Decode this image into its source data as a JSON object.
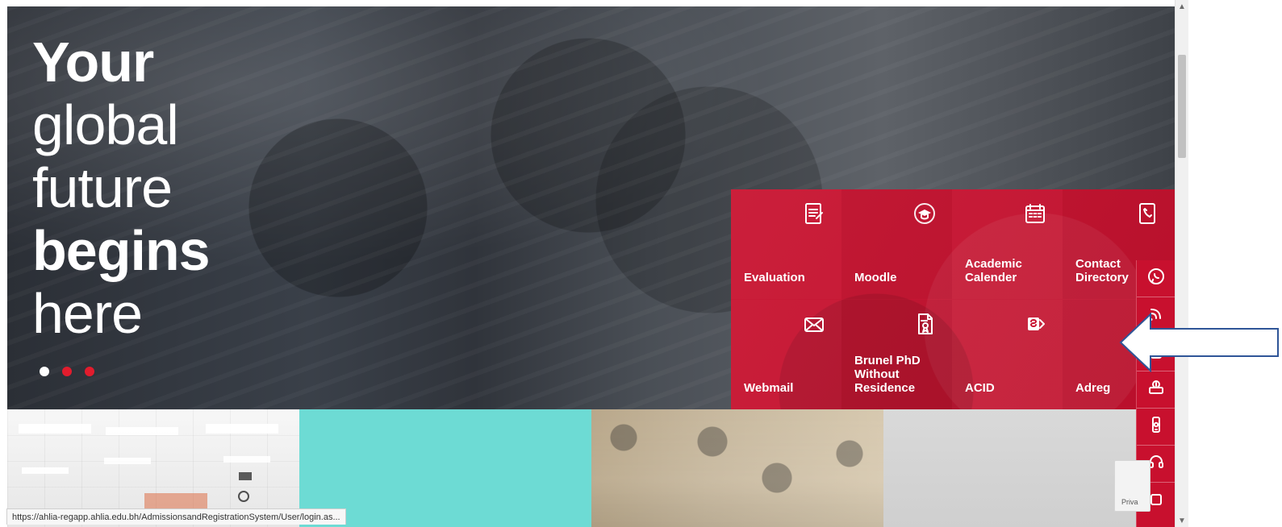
{
  "hero": {
    "headline": {
      "line1": "Your",
      "line2": "global",
      "line3": "future",
      "line4": "begins",
      "line5": "here"
    },
    "carousel": {
      "dots": [
        "active",
        "inactive",
        "inactive"
      ]
    }
  },
  "quick_links": {
    "tiles": [
      {
        "label": "Evaluation",
        "icon": "edit-document-icon"
      },
      {
        "label": "Moodle",
        "icon": "graduation-cap-icon"
      },
      {
        "label": "Academic\nCalender",
        "icon": "calendar-icon"
      },
      {
        "label": "Contact\nDirectory",
        "icon": "contact-directory-icon"
      },
      {
        "label": "Webmail",
        "icon": "mail-icon"
      },
      {
        "label": "Brunel PhD\nWithout\nResidence",
        "icon": "certificate-document-icon"
      },
      {
        "label": "ACID",
        "icon": "sharepoint-icon"
      },
      {
        "label": "Adreg",
        "icon": "blank-icon"
      }
    ]
  },
  "side_icons": {
    "items": [
      {
        "icon": "whatsapp-icon"
      },
      {
        "icon": "rss-icon"
      },
      {
        "icon": "calculator-icon"
      },
      {
        "icon": "payment-icon"
      },
      {
        "icon": "mobile-app-icon"
      },
      {
        "icon": "headset-icon"
      },
      {
        "icon": "more-icon"
      }
    ]
  },
  "status_bar": {
    "url": "https://ahlia-regapp.ahlia.edu.bh/AdmissionsandRegistrationSystem/User/login.as..."
  },
  "widgets": {
    "privacy_text": "Priva"
  },
  "colors": {
    "accent": "#c8102e",
    "annotation_arrow": "#2f5597",
    "teal_tile": "#6ddbd4"
  }
}
